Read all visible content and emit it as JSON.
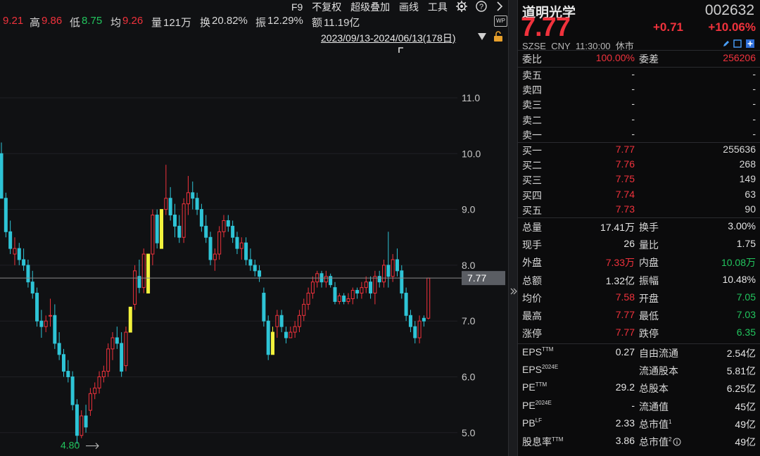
{
  "topbar": {
    "open_value": "9.21",
    "high_label": "高",
    "high_value": "9.86",
    "low_label": "低",
    "low_value": "8.75",
    "avg_label": "均",
    "avg_value": "9.26",
    "vol_label": "量",
    "vol_value": "121万",
    "turn_label": "换",
    "turn_value": "20.82%",
    "amp_label": "振",
    "amp_value": "12.29%",
    "amt_label": "额",
    "amt_value": "11.19亿",
    "menu": [
      "F9",
      "不复权",
      "超级叠加",
      "画线",
      "工具"
    ],
    "range_text": "2023/09/13-2024/06/13(178日)"
  },
  "chart_data": {
    "type": "candlestick",
    "y_axis_ticks": [
      "11.0",
      "10.0",
      "9.0",
      "8.0",
      "7.0",
      "6.0",
      "5.0"
    ],
    "ylim": [
      4.8,
      11.2
    ],
    "last_price_label": "7.77",
    "last_price": 7.77,
    "low_marker_label": "4.80",
    "low_marker_value": 4.8,
    "colors": {
      "up": "#f0323c",
      "down": "#2ec4d6",
      "limit": "#f2f23c"
    },
    "candles": [
      {
        "o": 10.0,
        "h": 10.2,
        "l": 9.2,
        "c": 9.2
      },
      {
        "o": 9.2,
        "h": 9.3,
        "l": 8.5,
        "c": 8.6
      },
      {
        "o": 8.6,
        "h": 8.8,
        "l": 8.2,
        "c": 8.3
      },
      {
        "o": 8.2,
        "h": 8.5,
        "l": 8.0,
        "c": 8.3
      },
      {
        "o": 8.3,
        "h": 8.4,
        "l": 8.0,
        "c": 8.1
      },
      {
        "o": 8.1,
        "h": 8.3,
        "l": 7.9,
        "c": 8.0
      },
      {
        "o": 8.0,
        "h": 8.1,
        "l": 7.6,
        "c": 7.7
      },
      {
        "o": 7.7,
        "h": 7.9,
        "l": 7.4,
        "c": 7.5
      },
      {
        "o": 7.5,
        "h": 7.6,
        "l": 6.9,
        "c": 7.0
      },
      {
        "o": 7.0,
        "h": 7.2,
        "l": 6.7,
        "c": 6.9
      },
      {
        "o": 6.9,
        "h": 7.1,
        "l": 6.8,
        "c": 7.0
      },
      {
        "o": 7.1,
        "h": 7.4,
        "l": 6.9,
        "c": 7.1
      },
      {
        "o": 7.1,
        "h": 7.3,
        "l": 6.5,
        "c": 6.6
      },
      {
        "o": 6.6,
        "h": 6.8,
        "l": 6.3,
        "c": 6.4
      },
      {
        "o": 6.4,
        "h": 6.5,
        "l": 6.0,
        "c": 6.1
      },
      {
        "o": 6.1,
        "h": 6.3,
        "l": 5.9,
        "c": 6.0
      },
      {
        "o": 6.0,
        "h": 6.1,
        "l": 5.4,
        "c": 5.5
      },
      {
        "o": 5.5,
        "h": 5.6,
        "l": 4.8,
        "c": 4.95
      },
      {
        "o": 4.95,
        "h": 5.4,
        "l": 4.9,
        "c": 5.3
      },
      {
        "o": 5.3,
        "h": 5.5,
        "l": 5.0,
        "c": 5.1
      },
      {
        "o": 5.4,
        "h": 5.8,
        "l": 5.3,
        "c": 5.7
      },
      {
        "o": 5.7,
        "h": 5.9,
        "l": 5.6,
        "c": 5.8
      },
      {
        "o": 5.8,
        "h": 6.1,
        "l": 5.7,
        "c": 6.0
      },
      {
        "o": 6.0,
        "h": 6.2,
        "l": 5.9,
        "c": 6.1
      },
      {
        "o": 6.1,
        "h": 6.6,
        "l": 6.0,
        "c": 6.5
      },
      {
        "o": 6.5,
        "h": 6.8,
        "l": 6.3,
        "c": 6.7
      },
      {
        "o": 6.7,
        "h": 6.9,
        "l": 6.5,
        "c": 6.6
      },
      {
        "o": 6.6,
        "h": 6.8,
        "l": 6.0,
        "c": 6.1
      },
      {
        "o": 6.2,
        "h": 6.9,
        "l": 6.1,
        "c": 6.8
      },
      {
        "o": 6.8,
        "h": 7.25,
        "l": 6.8,
        "c": 7.25,
        "limit": true
      },
      {
        "o": 7.3,
        "h": 8.0,
        "l": 7.2,
        "c": 7.9
      },
      {
        "o": 7.8,
        "h": 8.1,
        "l": 7.5,
        "c": 7.6
      },
      {
        "o": 7.6,
        "h": 8.3,
        "l": 7.5,
        "c": 8.2
      },
      {
        "o": 7.5,
        "h": 8.2,
        "l": 7.5,
        "c": 8.2,
        "limit": true
      },
      {
        "o": 8.2,
        "h": 9.0,
        "l": 8.0,
        "c": 8.9
      },
      {
        "o": 8.9,
        "h": 9.0,
        "l": 8.3,
        "c": 8.4
      },
      {
        "o": 8.3,
        "h": 9.0,
        "l": 8.3,
        "c": 9.0,
        "limit": true
      },
      {
        "o": 9.0,
        "h": 9.8,
        "l": 8.9,
        "c": 9.2
      },
      {
        "o": 9.2,
        "h": 9.4,
        "l": 8.8,
        "c": 8.9
      },
      {
        "o": 8.9,
        "h": 9.1,
        "l": 8.5,
        "c": 8.7
      },
      {
        "o": 8.7,
        "h": 8.9,
        "l": 8.4,
        "c": 8.5
      },
      {
        "o": 8.5,
        "h": 9.2,
        "l": 8.4,
        "c": 9.1
      },
      {
        "o": 9.1,
        "h": 9.6,
        "l": 8.9,
        "c": 9.3
      },
      {
        "o": 9.3,
        "h": 9.5,
        "l": 9.0,
        "c": 9.2
      },
      {
        "o": 9.2,
        "h": 9.3,
        "l": 8.9,
        "c": 9.0
      },
      {
        "o": 9.0,
        "h": 9.1,
        "l": 8.6,
        "c": 8.7
      },
      {
        "o": 8.7,
        "h": 8.9,
        "l": 8.4,
        "c": 8.5
      },
      {
        "o": 8.5,
        "h": 8.6,
        "l": 8.0,
        "c": 8.1
      },
      {
        "o": 8.1,
        "h": 8.3,
        "l": 7.9,
        "c": 8.2
      },
      {
        "o": 8.2,
        "h": 8.7,
        "l": 8.1,
        "c": 8.6
      },
      {
        "o": 8.6,
        "h": 8.9,
        "l": 8.5,
        "c": 8.8
      },
      {
        "o": 8.8,
        "h": 8.9,
        "l": 8.6,
        "c": 8.7
      },
      {
        "o": 8.7,
        "h": 8.8,
        "l": 8.4,
        "c": 8.5
      },
      {
        "o": 8.5,
        "h": 8.6,
        "l": 8.2,
        "c": 8.3
      },
      {
        "o": 8.3,
        "h": 8.5,
        "l": 8.1,
        "c": 8.4
      },
      {
        "o": 8.4,
        "h": 8.5,
        "l": 8.0,
        "c": 8.1
      },
      {
        "o": 8.1,
        "h": 8.3,
        "l": 7.9,
        "c": 8.0
      },
      {
        "o": 8.0,
        "h": 8.1,
        "l": 7.8,
        "c": 7.9
      },
      {
        "o": 7.9,
        "h": 8.0,
        "l": 7.7,
        "c": 7.8
      },
      {
        "o": 7.5,
        "h": 7.6,
        "l": 6.9,
        "c": 7.0
      },
      {
        "o": 7.0,
        "h": 7.1,
        "l": 6.3,
        "c": 6.4
      },
      {
        "o": 6.4,
        "h": 6.9,
        "l": 6.4,
        "c": 6.8,
        "limit": true
      },
      {
        "o": 6.9,
        "h": 7.2,
        "l": 6.7,
        "c": 7.1
      },
      {
        "o": 7.1,
        "h": 7.2,
        "l": 6.8,
        "c": 6.9
      },
      {
        "o": 6.8,
        "h": 6.9,
        "l": 6.6,
        "c": 6.7
      },
      {
        "o": 6.7,
        "h": 6.9,
        "l": 6.7,
        "c": 6.8
      },
      {
        "o": 6.8,
        "h": 7.0,
        "l": 6.7,
        "c": 6.9
      },
      {
        "o": 6.9,
        "h": 7.2,
        "l": 6.8,
        "c": 7.1
      },
      {
        "o": 7.1,
        "h": 7.4,
        "l": 7.0,
        "c": 7.3
      },
      {
        "o": 7.3,
        "h": 7.6,
        "l": 7.2,
        "c": 7.5
      },
      {
        "o": 7.5,
        "h": 7.8,
        "l": 7.4,
        "c": 7.7
      },
      {
        "o": 7.7,
        "h": 7.9,
        "l": 7.6,
        "c": 7.85
      },
      {
        "o": 7.85,
        "h": 7.9,
        "l": 7.6,
        "c": 7.7
      },
      {
        "o": 7.7,
        "h": 7.9,
        "l": 7.6,
        "c": 7.8
      },
      {
        "o": 7.8,
        "h": 7.85,
        "l": 7.6,
        "c": 7.65
      },
      {
        "o": 7.6,
        "h": 7.7,
        "l": 7.3,
        "c": 7.35
      },
      {
        "o": 7.35,
        "h": 7.5,
        "l": 7.3,
        "c": 7.45
      },
      {
        "o": 7.45,
        "h": 7.5,
        "l": 7.3,
        "c": 7.35
      },
      {
        "o": 7.35,
        "h": 7.5,
        "l": 7.3,
        "c": 7.4
      },
      {
        "o": 7.4,
        "h": 7.6,
        "l": 7.3,
        "c": 7.55
      },
      {
        "o": 7.55,
        "h": 7.6,
        "l": 7.4,
        "c": 7.5
      },
      {
        "o": 7.5,
        "h": 7.7,
        "l": 7.4,
        "c": 7.6
      },
      {
        "o": 7.6,
        "h": 7.8,
        "l": 7.5,
        "c": 7.7
      },
      {
        "o": 7.7,
        "h": 7.8,
        "l": 7.4,
        "c": 7.5
      },
      {
        "o": 7.5,
        "h": 7.9,
        "l": 7.3,
        "c": 7.8
      },
      {
        "o": 7.8,
        "h": 7.9,
        "l": 7.6,
        "c": 7.7
      },
      {
        "o": 7.7,
        "h": 8.1,
        "l": 7.6,
        "c": 8.0
      },
      {
        "o": 8.0,
        "h": 8.6,
        "l": 7.6,
        "c": 7.8
      },
      {
        "o": 7.8,
        "h": 8.2,
        "l": 7.7,
        "c": 8.1
      },
      {
        "o": 8.1,
        "h": 8.3,
        "l": 7.8,
        "c": 7.9
      },
      {
        "o": 7.9,
        "h": 8.0,
        "l": 7.4,
        "c": 7.5
      },
      {
        "o": 7.5,
        "h": 7.6,
        "l": 7.0,
        "c": 7.1
      },
      {
        "o": 7.1,
        "h": 7.2,
        "l": 6.8,
        "c": 6.9
      },
      {
        "o": 6.9,
        "h": 7.0,
        "l": 6.6,
        "c": 6.7
      },
      {
        "o": 6.7,
        "h": 7.1,
        "l": 6.6,
        "c": 7.0
      },
      {
        "o": 7.05,
        "h": 7.1,
        "l": 6.9,
        "c": 7.0
      },
      {
        "o": 7.05,
        "h": 7.77,
        "l": 7.03,
        "c": 7.77
      }
    ]
  },
  "panel": {
    "stock_name": "道明光学",
    "stock_code": "002632",
    "price": "7.77",
    "change": "+0.71",
    "change_pct": "+10.06%",
    "exchange": "SZSE",
    "currency": "CNY",
    "time": "11:30:00",
    "status": "休市",
    "weibi_label": "委比",
    "weibi_value": "100.00%",
    "weicha_label": "委差",
    "weicha_value": "256206",
    "asks": [
      {
        "label": "卖五",
        "price": "-",
        "vol": "-"
      },
      {
        "label": "卖四",
        "price": "-",
        "vol": "-"
      },
      {
        "label": "卖三",
        "price": "-",
        "vol": "-"
      },
      {
        "label": "卖二",
        "price": "-",
        "vol": "-"
      },
      {
        "label": "卖一",
        "price": "-",
        "vol": "-"
      }
    ],
    "bids": [
      {
        "label": "买一",
        "price": "7.77",
        "vol": "255636"
      },
      {
        "label": "买二",
        "price": "7.76",
        "vol": "268"
      },
      {
        "label": "买三",
        "price": "7.75",
        "vol": "149"
      },
      {
        "label": "买四",
        "price": "7.74",
        "vol": "63"
      },
      {
        "label": "买五",
        "price": "7.73",
        "vol": "90"
      }
    ],
    "stats": [
      {
        "l1": "总量",
        "v1": "17.41万",
        "c1": "white",
        "l2": "换手",
        "v2": "3.00%",
        "c2": "white"
      },
      {
        "l1": "现手",
        "v1": "26",
        "c1": "white",
        "l2": "量比",
        "v2": "1.75",
        "c2": "white"
      },
      {
        "l1": "外盘",
        "v1": "7.33万",
        "c1": "red",
        "l2": "内盘",
        "v2": "10.08万",
        "c2": "green"
      },
      {
        "l1": "总额",
        "v1": "1.32亿",
        "c1": "white",
        "l2": "振幅",
        "v2": "10.48%",
        "c2": "white"
      },
      {
        "l1": "均价",
        "v1": "7.58",
        "c1": "red",
        "l2": "开盘",
        "v2": "7.05",
        "c2": "green"
      },
      {
        "l1": "最高",
        "v1": "7.77",
        "c1": "red",
        "l2": "最低",
        "v2": "7.03",
        "c2": "green"
      },
      {
        "l1": "涨停",
        "v1": "7.77",
        "c1": "red",
        "l2": "跌停",
        "v2": "6.35",
        "c2": "green"
      }
    ],
    "fund": [
      {
        "l1": "EPS",
        "s1": "TTM",
        "v1": "0.27",
        "l2": "自由流通",
        "s2": "",
        "v2": "2.54亿"
      },
      {
        "l1": "EPS",
        "s1": "2024E",
        "v1": "",
        "l2": "流通股本",
        "s2": "",
        "v2": "5.81亿"
      },
      {
        "l1": "PE",
        "s1": "TTM",
        "v1": "29.2",
        "l2": "总股本",
        "s2": "",
        "v2": "6.25亿"
      },
      {
        "l1": "PE",
        "s1": "2024E",
        "v1": "-",
        "l2": "流通值",
        "s2": "",
        "v2": "45亿"
      },
      {
        "l1": "PB",
        "s1": "LF",
        "v1": "2.33",
        "l2": "总市值",
        "s2": "1",
        "v2": "49亿"
      },
      {
        "l1": "股息率",
        "s1": "TTM",
        "v1": "3.86",
        "l2": "总市值",
        "s2": "2",
        "v2": "49亿"
      }
    ]
  }
}
